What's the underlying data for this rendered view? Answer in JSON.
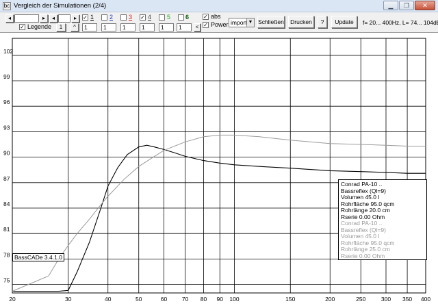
{
  "window": {
    "title": "Vergleich der Simulationen (2/4)",
    "icon": "bc",
    "controls": [
      "▁",
      "❐",
      "✕"
    ]
  },
  "toolbar": {
    "nav": {
      "first": "◂",
      "prev_field": "",
      "next_arrow": "▸",
      "first2": "◂",
      "field2": "",
      "next2": "▸"
    },
    "legend_label": "Legende",
    "legend_checked": true,
    "num_btn": "1",
    "caret_btn": "^",
    "series": [
      {
        "label": "1",
        "color": "#000000",
        "checked": true,
        "value": "1"
      },
      {
        "label": "2",
        "color": "#2040c0",
        "checked": false,
        "value": "1"
      },
      {
        "label": "3",
        "color": "#d02020",
        "checked": false,
        "value": "1"
      },
      {
        "label": "4",
        "color": "#404040",
        "checked": true,
        "value": "1"
      },
      {
        "label": "5",
        "color": "#20a020",
        "checked": false,
        "value": "1"
      },
      {
        "label": "6",
        "color": "#106010",
        "checked": false,
        "value": "1"
      }
    ],
    "lt_btn": "<",
    "abs_label": "abs",
    "abs_checked": true,
    "power_label": "Power",
    "power_checked": true,
    "import_select": "import",
    "schliessen": "Schließen",
    "drucken": "Drucken",
    "help": "?",
    "update": "Update",
    "info": "f= 20... 400Hz, L= 74... 104dB"
  },
  "chart_data": {
    "type": "line",
    "xlabel": "",
    "ylabel": "",
    "xscale": "log",
    "xlim": [
      20,
      400
    ],
    "ylim": [
      74,
      104
    ],
    "x_ticks": [
      20,
      30,
      40,
      50,
      60,
      70,
      80,
      90,
      100,
      150,
      200,
      250,
      300,
      350,
      400
    ],
    "y_ticks": [
      75,
      78,
      81,
      84,
      87,
      90,
      93,
      96,
      99,
      102
    ],
    "grid": true,
    "series": [
      {
        "name": "1",
        "color": "#000000",
        "x": [
          20,
          25,
          28,
          30,
          32,
          35,
          38,
          40,
          43,
          46,
          50,
          53,
          56,
          60,
          65,
          70,
          80,
          90,
          100,
          120,
          150,
          200,
          250,
          300,
          350,
          400
        ],
        "y": [
          74.2,
          74.2,
          74.2,
          74.3,
          76.5,
          80.0,
          84.0,
          86.6,
          88.8,
          90.3,
          91.2,
          91.4,
          91.2,
          90.9,
          90.5,
          90.1,
          89.6,
          89.3,
          89.1,
          88.9,
          88.7,
          88.4,
          88.3,
          88.2,
          88.1,
          88.1
        ]
      },
      {
        "name": "4",
        "color": "#9a9a9a",
        "x": [
          20,
          26,
          28,
          30,
          32,
          35,
          38,
          40,
          45,
          50,
          55,
          60,
          70,
          80,
          90,
          100,
          120,
          150,
          200,
          250,
          300,
          350,
          400
        ],
        "y": [
          74.2,
          76.0,
          78.0,
          79.6,
          81.0,
          82.7,
          84.4,
          85.4,
          87.4,
          88.9,
          89.9,
          90.8,
          91.8,
          92.4,
          92.6,
          92.6,
          92.4,
          92.0,
          91.6,
          91.5,
          91.4,
          91.3,
          91.3
        ]
      }
    ]
  },
  "legend": {
    "set1": [
      "Conrad PA-10 ..",
      "Bassreflex (Ql=9)",
      "Volumen 45.0 l",
      "Rohrfläche 95.0 qcm",
      "Rohrlänge 20.0 cm",
      "Rserie 0.00 Ohm"
    ],
    "set2": [
      "Conrad PA-10 ..",
      "Bassreflex (Ql=9)",
      "Volumen 45.0 l",
      "Rohrfläche 95.0 qcm",
      "Rohrlänge 25.0 cm",
      "Rserie 0.00 Ohm"
    ]
  },
  "version": "BassCADe 3.4.1.0"
}
